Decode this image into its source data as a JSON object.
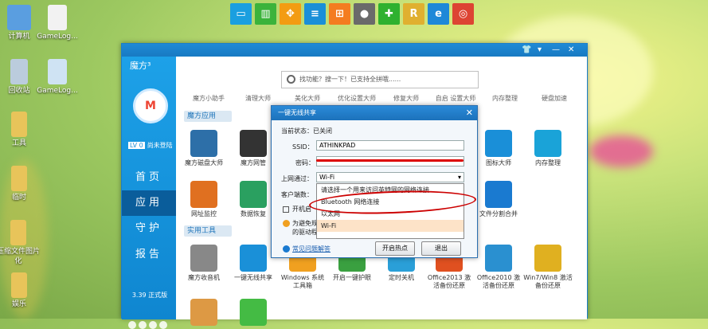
{
  "desktop_icons": [
    {
      "label": "计算机",
      "icon": "computer-icon",
      "color": "#5a9ee0"
    },
    {
      "label": "GameLog...",
      "icon": "document-icon",
      "color": "#f2f2f2"
    },
    {
      "label": "回收站",
      "icon": "recycle-bin-icon",
      "color": "#bcd"
    },
    {
      "label": "GameLog...",
      "icon": "document-icon",
      "color": "#cfe3f3"
    },
    {
      "label": "工具",
      "icon": "folder-icon",
      "color": "#e8c45a"
    },
    {
      "label": "临时",
      "icon": "folder-icon",
      "color": "#e8c45a"
    },
    {
      "label": "压缩文件图片化",
      "icon": "folder-icon",
      "color": "#e8c45a"
    },
    {
      "label": "娱乐",
      "icon": "folder-icon",
      "color": "#e8c45a"
    }
  ],
  "topbar_icons": [
    {
      "name": "monitor-icon",
      "color": "#1a9fe0",
      "glyph": "▭"
    },
    {
      "name": "trash-icon",
      "color": "#3bb33b",
      "glyph": "▥"
    },
    {
      "name": "grid-icon",
      "color": "#f39c12",
      "glyph": "✥"
    },
    {
      "name": "list-icon",
      "color": "#1a8fd8",
      "glyph": "≡"
    },
    {
      "name": "windows-icon",
      "color": "#f47c20",
      "glyph": "⊞"
    },
    {
      "name": "apple-icon",
      "color": "#6a6a6a",
      "glyph": "●"
    },
    {
      "name": "gamepad-icon",
      "color": "#2fb12f",
      "glyph": "✚"
    },
    {
      "name": "r-icon",
      "color": "#e0b030",
      "glyph": "R"
    },
    {
      "name": "ie-icon",
      "color": "#1e88d8",
      "glyph": "e"
    },
    {
      "name": "chrome-icon",
      "color": "#dd4433",
      "glyph": "◎"
    }
  ],
  "window": {
    "logo": "魔方³",
    "avatar_text": "M",
    "level": "LV 0",
    "login": "尚未登陆",
    "nav": [
      "首页",
      "应用",
      "守护",
      "报告"
    ],
    "version": "3.39 正式版",
    "search_placeholder": "找功能？搜一下！已支持全拼哦......",
    "categories": [
      "魔方小助手",
      "清理大师",
      "美化大师",
      "优化设置大师",
      "修复大师",
      "自启 设置大师",
      "内存整理",
      "硬盘加速"
    ],
    "section1": "魔方应用",
    "section2": "实用工具",
    "apps_row1": [
      {
        "label": "魔方磁盘大师",
        "color": "#2d6fa8"
      },
      {
        "label": "魔方网管",
        "color": "#333"
      },
      {
        "label": "图标大师",
        "color": "#1a8fd8"
      },
      {
        "label": "内存整理",
        "color": "#1aa3d8"
      }
    ],
    "apps_row2": [
      {
        "label": "网址监控",
        "color": "#e07020"
      },
      {
        "label": "数据恢复",
        "color": "#2aa060"
      },
      {
        "label": "文件分割合并",
        "color": "#1a7ad0"
      }
    ],
    "apps_row3": [
      {
        "label": "魔方收音机",
        "color": "#888"
      },
      {
        "label": "一键无线共享",
        "color": "#1a90d8"
      },
      {
        "label": "Windows 系统工具箱",
        "color": "#f0a020"
      },
      {
        "label": "开启一键护眼",
        "color": "#3aa040"
      },
      {
        "label": "定时关机",
        "color": "#2a9fd8"
      },
      {
        "label": "Office2013 激活备份还原",
        "color": "#e05020"
      },
      {
        "label": "Office2010 激活备份还原",
        "color": "#2a90d0"
      },
      {
        "label": "Win7/Win8 激活备份还原",
        "color": "#e0b020"
      }
    ]
  },
  "dialog": {
    "title": "一键无线共享",
    "status_label": "当前状态：",
    "status_value": "已关闭",
    "ssid_label": "SSID：",
    "ssid_value": "ATHINKPAD",
    "password_label": "密码：",
    "password_value": "",
    "internet_label": "上网通过：",
    "internet_value": "Wi-Fi",
    "clients_label": "客户端数：",
    "autostart_label": "开机启",
    "note_text": "为避免规...",
    "note_text2": "的驱动程",
    "faq_link": "常见问题解答",
    "start_button": "开启热点",
    "exit_button": "退出",
    "dropdown_options": [
      "请选择一个用来访问英特网的网络连接",
      "Bluetooth 网络连接",
      "以太网",
      "Wi-Fi"
    ]
  }
}
